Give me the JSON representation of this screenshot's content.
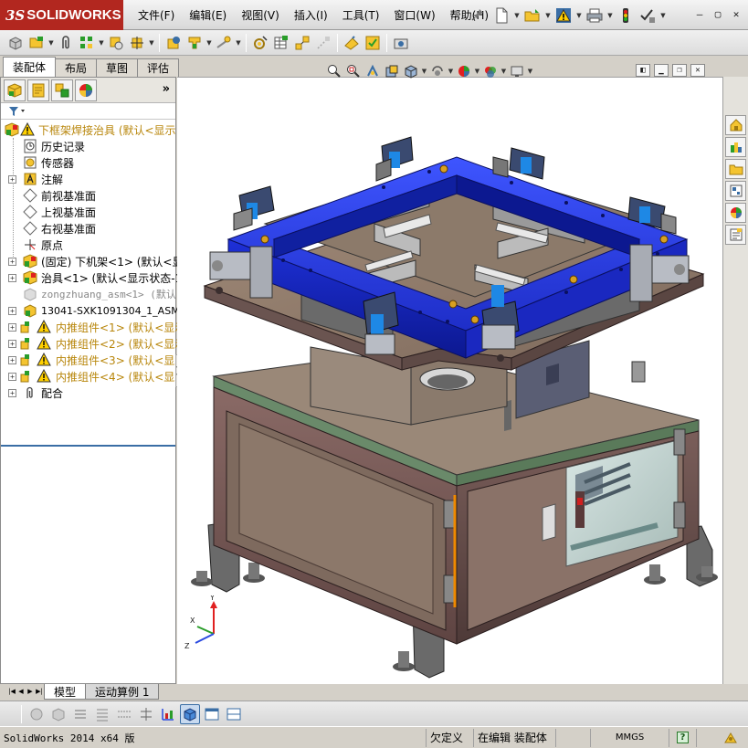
{
  "app": {
    "logo_prefix": "3S",
    "logo_name": "SOLIDWORKS"
  },
  "menu": {
    "items": [
      "文件(F)",
      "编辑(E)",
      "视图(V)",
      "插入(I)",
      "工具(T)",
      "窗口(W)",
      "帮助(H)"
    ]
  },
  "manager_tabs": [
    "装配体",
    "布局",
    "草图",
    "评估"
  ],
  "tree": {
    "root": "下框架焊接治具 (默认<显示",
    "items": [
      {
        "label": "历史记录",
        "icon": "history-icon"
      },
      {
        "label": "传感器",
        "icon": "sensor-icon"
      },
      {
        "label": "注解",
        "icon": "annotation-icon"
      },
      {
        "label": "前视基准面",
        "icon": "plane-icon"
      },
      {
        "label": "上视基准面",
        "icon": "plane-icon"
      },
      {
        "label": "右视基准面",
        "icon": "plane-icon"
      },
      {
        "label": "原点",
        "icon": "origin-icon"
      },
      {
        "label": "(固定) 下机架<1> (默认<显",
        "icon": "assembly-icon"
      },
      {
        "label": "治具<1> (默认<显示状态-1>",
        "icon": "assembly-icon"
      },
      {
        "label": "zongzhuang_asm<1> (默认)",
        "icon": "suppressed-part-icon"
      },
      {
        "label": "13041-SXK1091304_1_ASM_1_",
        "icon": "part-icon"
      },
      {
        "label": "内推组件<1> (默认<显示",
        "icon": "warning-assembly-icon"
      },
      {
        "label": "内推组件<2> (默认<显示",
        "icon": "warning-assembly-icon"
      },
      {
        "label": "内推组件<3> (默认<显示",
        "icon": "warning-assembly-icon"
      },
      {
        "label": "内推组件<4> (默认<显示",
        "icon": "warning-assembly-icon"
      },
      {
        "label": "配合",
        "icon": "mates-icon"
      }
    ]
  },
  "bottom_tabs": [
    "模型",
    "运动算例 1"
  ],
  "status": {
    "app": "SolidWorks 2014 x64 版",
    "definition": "欠定义",
    "mode": "在编辑 装配体",
    "units": "MMGS",
    "help": "?"
  },
  "colors": {
    "logo_red": "#b2271f",
    "frame_blue": "#2a3ff0",
    "cabinet_brown": "#7a5c58",
    "plate_brown": "#8a7068",
    "accent_orange": "#f08a00"
  }
}
